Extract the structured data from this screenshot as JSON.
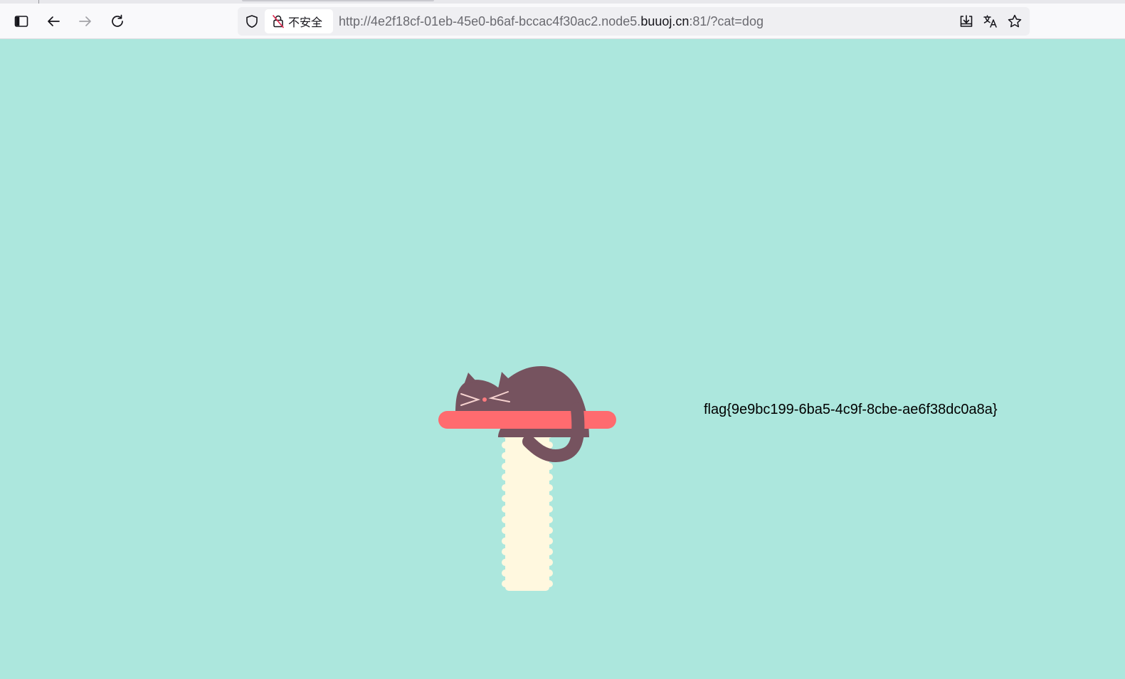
{
  "browser": {
    "security_label": "不安全",
    "url": {
      "prefix": "http://4e2f18cf-01eb-45e0-b6af-bccac4f30ac2.node5.",
      "domain": "buuoj.cn",
      "suffix": ":81/?cat=dog"
    },
    "icons": {
      "sidebar": "sidebar-toggle-icon",
      "back": "back-arrow-icon",
      "forward": "forward-arrow-icon",
      "reload": "reload-icon",
      "shield": "shield-icon",
      "insecure": "insecure-lock-icon",
      "save": "save-page-icon",
      "translate": "translate-icon",
      "bookmark": "star-icon"
    }
  },
  "page": {
    "flag_text": "flag{9e9bc199-6ba5-4c9f-8cbe-ae6f38dc0a8a}",
    "colors": {
      "background": "#ace7dd",
      "cat": "#76535f",
      "shelf": "#ff6b6f",
      "post": "#fff8df",
      "whiskers": "#f6d2cf",
      "nose": "#ff7a7e"
    }
  }
}
